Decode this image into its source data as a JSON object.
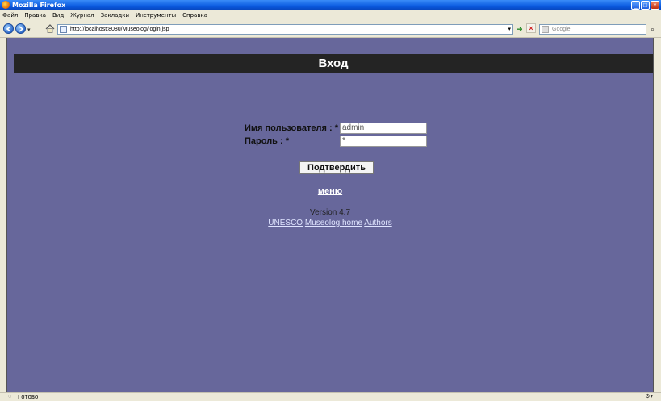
{
  "window": {
    "title": "Mozilla Firefox"
  },
  "menubar": [
    "Файл",
    "Правка",
    "Вид",
    "Журнал",
    "Закладки",
    "Инструменты",
    "Справка"
  ],
  "navbar": {
    "url": "http://localhost:8080/Museolog/login.jsp",
    "search_placeholder": "Google"
  },
  "page": {
    "heading": "Вход",
    "username_label": "Имя пользователя : *",
    "username_value": "admin",
    "password_label": "Пароль : *",
    "password_value": "*",
    "submit_label": "Подтвердить",
    "menu_link": "меню",
    "version": "Version 4.7",
    "footer_links": [
      "UNESCO",
      "Museolog home",
      "Authors"
    ]
  },
  "status": {
    "text": "Готово"
  },
  "colors": {
    "content_bg": "#67679b",
    "header_bg": "#242424",
    "titlebar": "#0a5ae0"
  }
}
